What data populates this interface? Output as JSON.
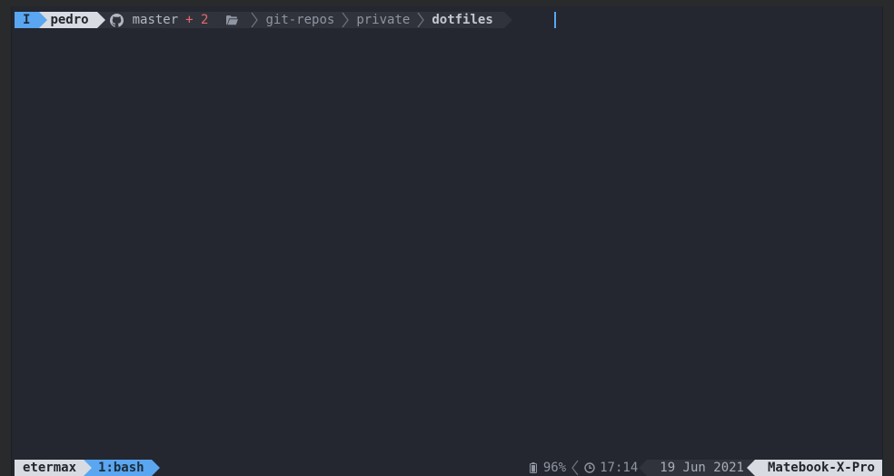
{
  "prompt": {
    "mode": "I",
    "user": "pedro",
    "git": {
      "icon": "github-icon",
      "branch": "master",
      "dirty": "+ 2"
    },
    "path": {
      "icon": "folder-icon",
      "parts": [
        "git-repos",
        "private"
      ],
      "current": "dotfiles"
    }
  },
  "status": {
    "session": "etermax",
    "window": "1:bash",
    "battery": "96%",
    "time": "17:14",
    "date": "19 Jun 2021",
    "host": "Matebook-X-Pro"
  },
  "colors": {
    "accent": "#5aa6f0",
    "background": "#242730",
    "segment_light": "#d8dbe1",
    "segment_dark": "#30333b",
    "dirty": "#e86a6a"
  }
}
